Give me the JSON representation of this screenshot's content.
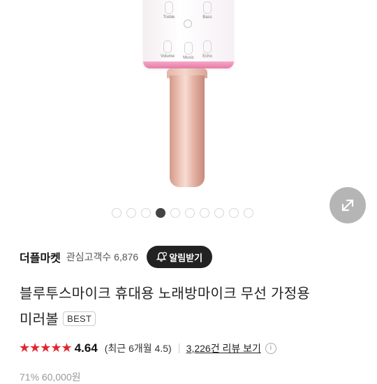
{
  "product_image": {
    "buttons": [
      "Treble",
      "Bass",
      "Volume",
      "Music",
      "Echo"
    ],
    "carousel": {
      "total": 10,
      "active": 3
    }
  },
  "seller": {
    "name": "더플마켓",
    "followers_label": "관심고객수 6,876",
    "notify_label": "알림받기"
  },
  "product": {
    "title_line1": "블루투스마이크 휴대용 노래방마이크 무선 가정용",
    "title_line2": "미러볼",
    "badge": "BEST"
  },
  "rating": {
    "stars": "★★★★★",
    "value": "4.64",
    "recent": "(최근 6개월 4.5)",
    "reviews_link": "3,226건 리뷰 보기",
    "info_glyph": "i",
    "star_color": "#e1262e"
  },
  "price_peek": "71% 60,000원"
}
